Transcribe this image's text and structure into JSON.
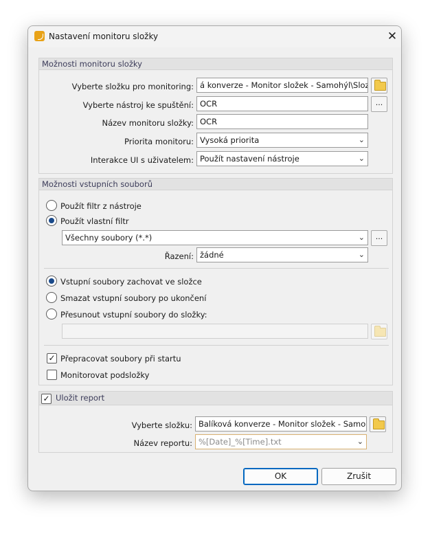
{
  "window": {
    "title": "Nastavení monitoru složky",
    "icon": "app-icon",
    "close_glyph": "✕"
  },
  "monitor_options": {
    "header": "Možnosti monitoru složky",
    "folder_label": "Vyberte složku pro monitoring:",
    "folder_value": "á konverze - Monitor složek - Samohýl\\Slozka",
    "tool_label": "Vyberte nástroj ke spuštění:",
    "tool_value": "OCR",
    "tool_browse": "...",
    "name_label": "Název monitoru složky:",
    "name_value": "OCR",
    "priority_label": "Priorita monitoru:",
    "priority_value": "Vysoká priorita",
    "ui_label": "Interakce UI s uživatelem:",
    "ui_value": "Použít nastavení nástroje"
  },
  "input_options": {
    "header": "Možnosti vstupních souborů",
    "radio_tool_filter": "Použít filtr z nástroje",
    "radio_custom_filter": "Použít vlastní filtr",
    "filter_value": "Všechny soubory (*.*)",
    "filter_browse": "...",
    "sort_label": "Řazení:",
    "sort_value": "žádné",
    "radio_keep": "Vstupní soubory zachovat ve složce",
    "radio_delete": "Smazat vstupní soubory po ukončení",
    "radio_move": "Přesunout vstupní soubory do složky:",
    "move_folder_value": "",
    "check_reprocess": "Přepracovat soubory při startu",
    "check_subfolders": "Monitorovat podsložky",
    "reprocess_checked": true,
    "subfolders_checked": false,
    "selected_filter": "custom",
    "selected_file_action": "keep"
  },
  "report": {
    "header": "Uložit report",
    "checked": true,
    "folder_label": "Vyberte složku:",
    "folder_value": "Balíková konverze - Monitor složek - Samohýl",
    "name_label": "Název reportu:",
    "name_value": "%[Date]_%[Time].txt"
  },
  "buttons": {
    "ok": "OK",
    "cancel": "Zrušit"
  },
  "colors": {
    "accent": "#0067c0",
    "radio_dot": "#1a4a8a",
    "folder_icon": "#f2c94c",
    "app_icon": "#e8a217"
  },
  "glyphs": {
    "chevron": "⌄",
    "check": "✓"
  }
}
